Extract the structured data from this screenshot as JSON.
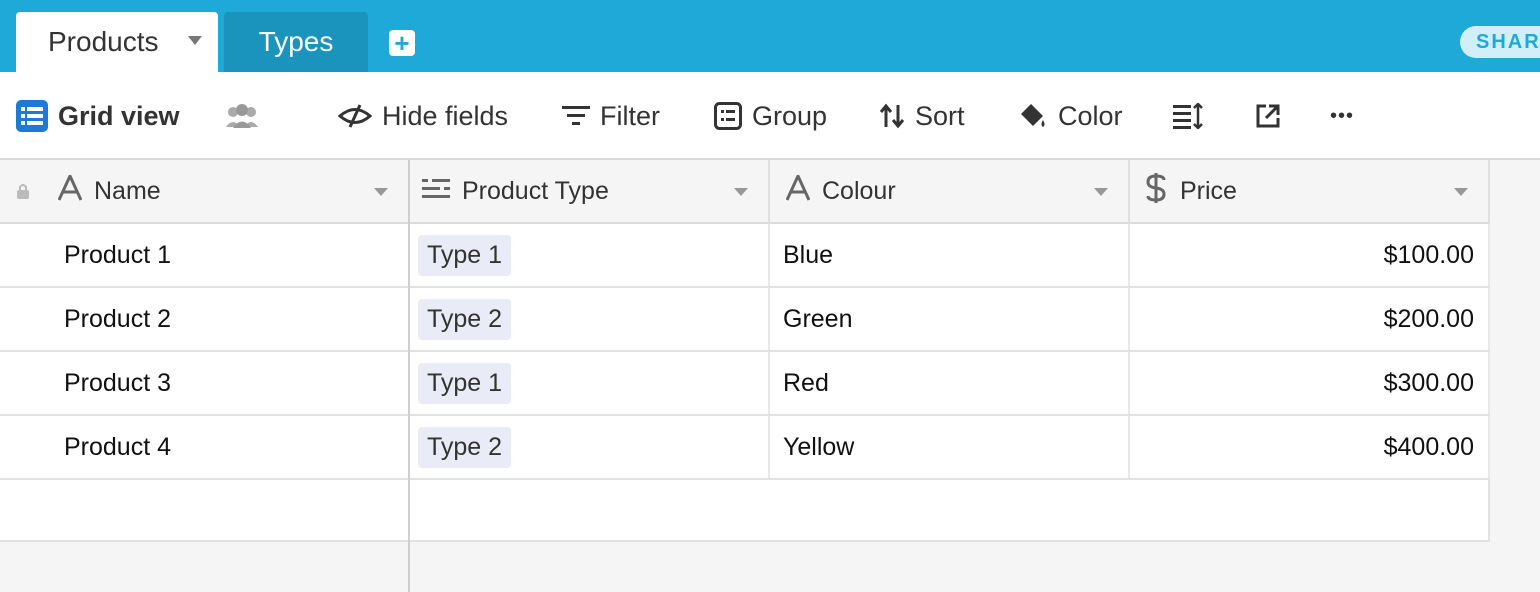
{
  "tabs": [
    {
      "label": "Products",
      "active": true
    },
    {
      "label": "Types",
      "active": false
    }
  ],
  "share_label": "SHAR",
  "toolbar": {
    "view_name": "Grid view",
    "hide_fields": "Hide fields",
    "filter": "Filter",
    "group": "Group",
    "sort": "Sort",
    "color": "Color",
    "more": "•••"
  },
  "columns": [
    {
      "label": "Name",
      "icon": "text-field-icon"
    },
    {
      "label": "Product Type",
      "icon": "linked-record-icon"
    },
    {
      "label": "Colour",
      "icon": "text-field-icon"
    },
    {
      "label": "Price",
      "icon": "currency-icon"
    }
  ],
  "rows": [
    {
      "name": "Product 1",
      "type": "Type 1",
      "colour": "Blue",
      "price": "$100.00"
    },
    {
      "name": "Product 2",
      "type": "Type 2",
      "colour": "Green",
      "price": "$200.00"
    },
    {
      "name": "Product 3",
      "type": "Type 1",
      "colour": "Red",
      "price": "$300.00"
    },
    {
      "name": "Product 4",
      "type": "Type 2",
      "colour": "Yellow",
      "price": "$400.00"
    }
  ],
  "colors": {
    "accent": "#1fa9d8",
    "chip": "#e9ecf7"
  }
}
